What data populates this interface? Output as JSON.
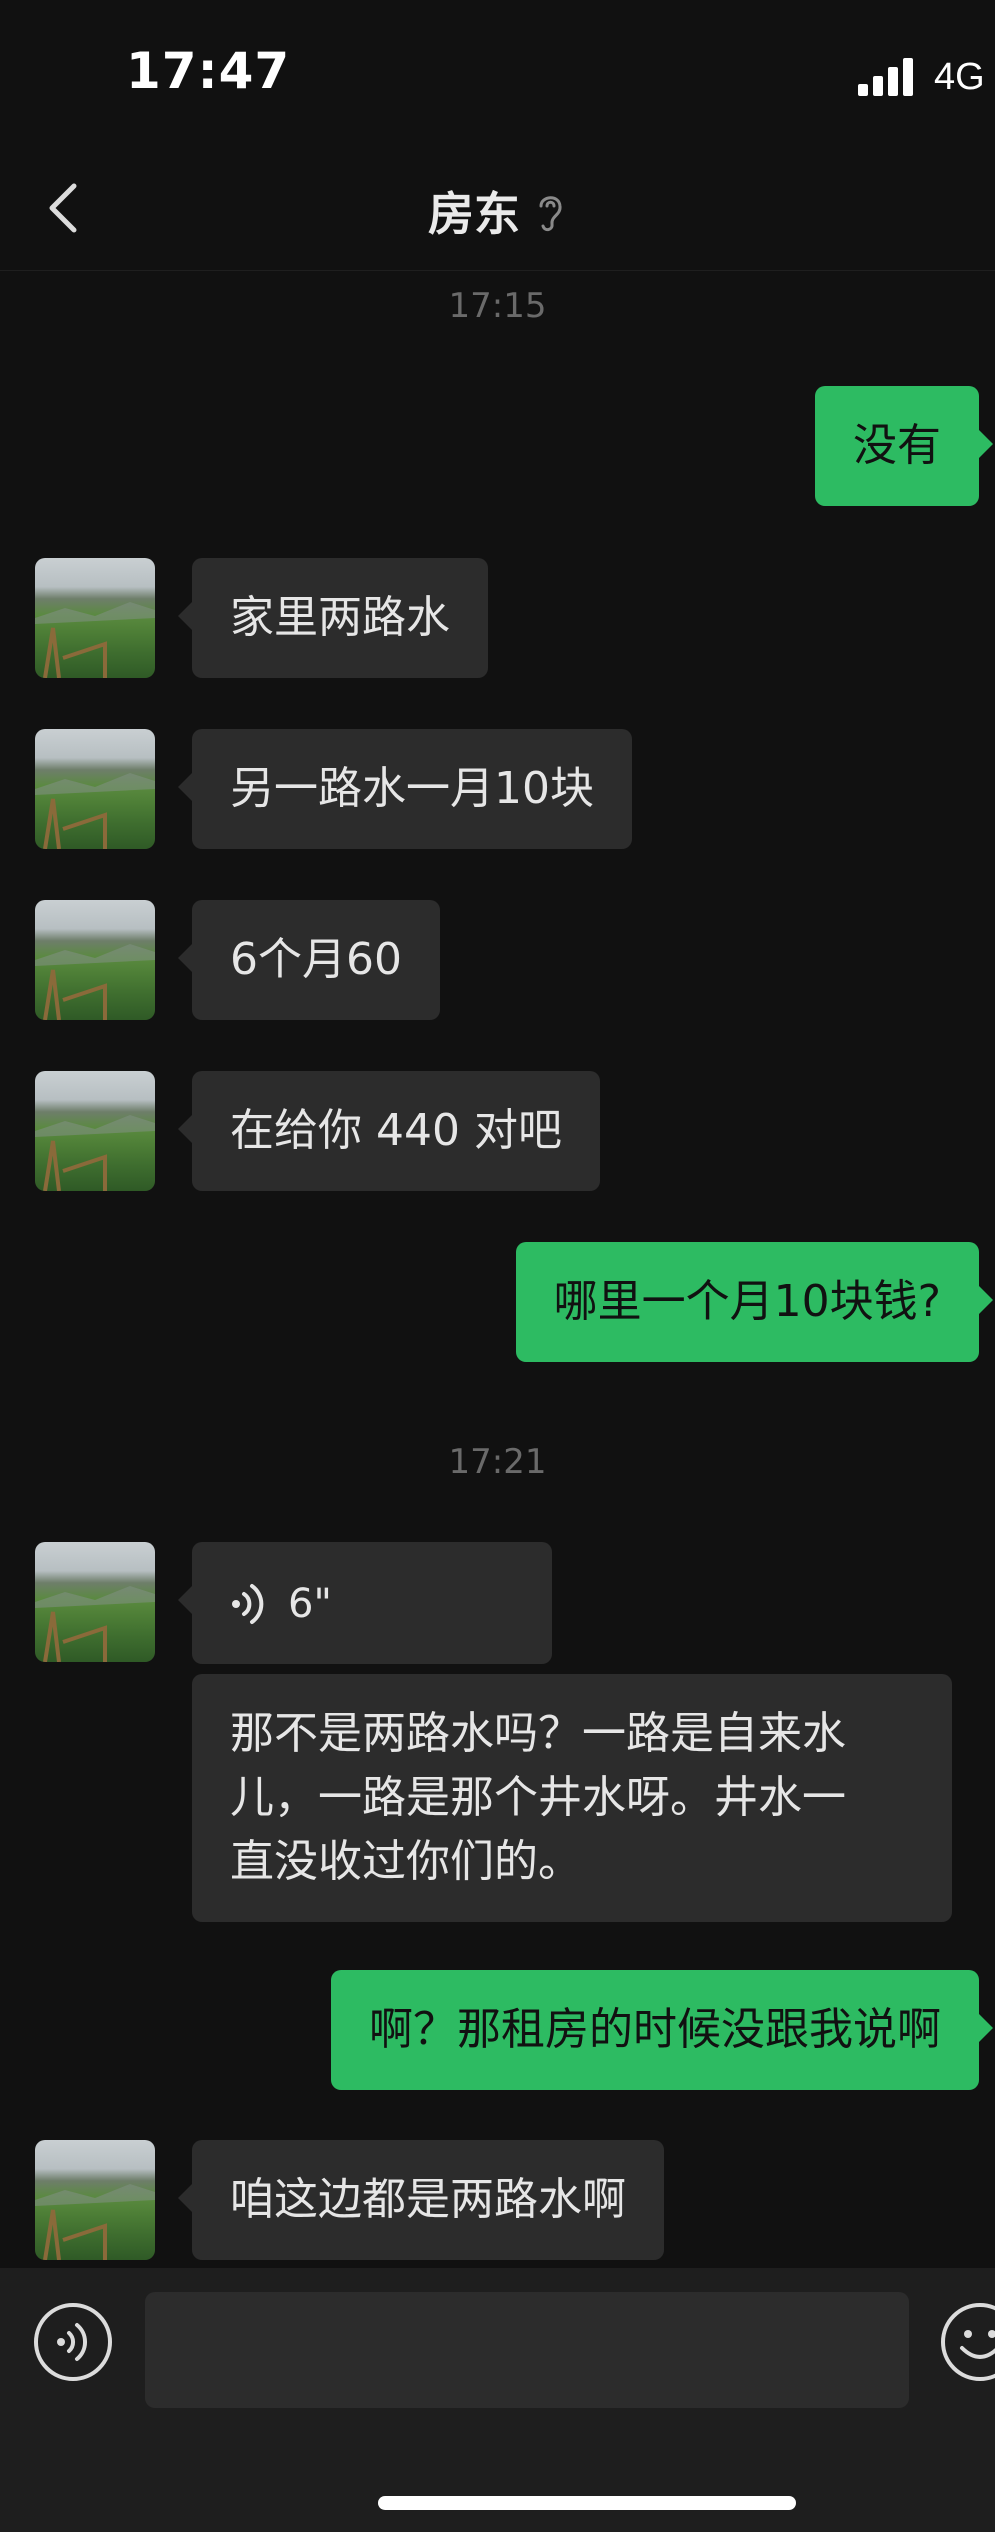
{
  "status_bar": {
    "time": "17:47",
    "network": "4G"
  },
  "nav": {
    "title": "房东"
  },
  "messages": {
    "t1": "17:15",
    "m1": "没有",
    "m2": "家里两路水",
    "m3": "另一路水一月10块",
    "m4": "6个月60",
    "m5": "在给你 440 对吧",
    "m6": "哪里一个月10块钱?",
    "t2": "17:21",
    "voice_duration": "6\"",
    "m7_line1": "那不是两路水吗？一路是自来水",
    "m7_line2": "儿，一路是那个井水呀。井水一",
    "m7_line3": "直没收过你们的。",
    "m8": "啊？那租房的时候没跟我说啊",
    "m9": "咱这边都是两路水啊"
  },
  "colors": {
    "outgoing": "#2dbb62",
    "incoming": "#2c2c2c",
    "background": "#111111"
  }
}
